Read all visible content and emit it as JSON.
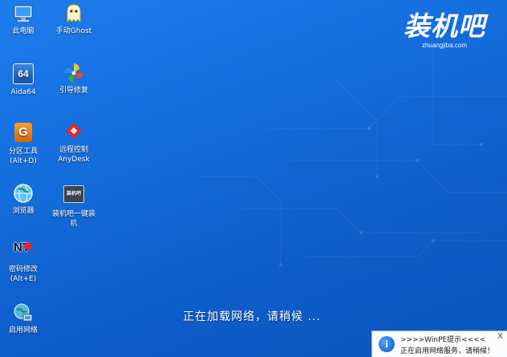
{
  "desktop": {
    "icons": [
      {
        "name": "this-pc",
        "label": "此电脑",
        "icon": "computer-icon"
      },
      {
        "name": "manual-ghost",
        "label": "手动Ghost",
        "icon": "ghost-icon"
      },
      {
        "name": "aida64",
        "label": "Aida64",
        "icon": "aida64-icon",
        "glyph_text": "64"
      },
      {
        "name": "boot-repair",
        "label": "引导修复",
        "icon": "pinwheel-icon"
      },
      {
        "name": "partition-tool",
        "label": "分区工具\n(Alt+D)",
        "icon": "partition-icon",
        "glyph_text": "G"
      },
      {
        "name": "remote-control",
        "label": "远程控制\nAnyDesk",
        "icon": "anydesk-icon"
      },
      {
        "name": "browser",
        "label": "浏览器",
        "icon": "globe-icon"
      },
      {
        "name": "one-key-install",
        "label": "装机吧一键装\n机",
        "icon": "installer-icon",
        "glyph_text": "装机吧"
      },
      {
        "name": "password-edit",
        "label": "密码修改\n(Alt+E)",
        "icon": "nt-password-icon",
        "glyph_text": "NT"
      },
      {
        "name": "enable-network",
        "label": "启用网络",
        "icon": "network-icon"
      }
    ]
  },
  "brand": {
    "logo": "装机吧",
    "url": "zhuangjiba.com"
  },
  "loading": {
    "text": "正在加载网络，请稍候 ..."
  },
  "notification": {
    "title": ">>>>WinPE提示<<<<",
    "message": "正在启用网络服务，请稍候！",
    "close": "X",
    "icon_char": "i"
  },
  "colors": {
    "background_top": "#1d7cec",
    "background_bottom": "#0a56bf",
    "notification_bg": "#fbfcfe"
  }
}
